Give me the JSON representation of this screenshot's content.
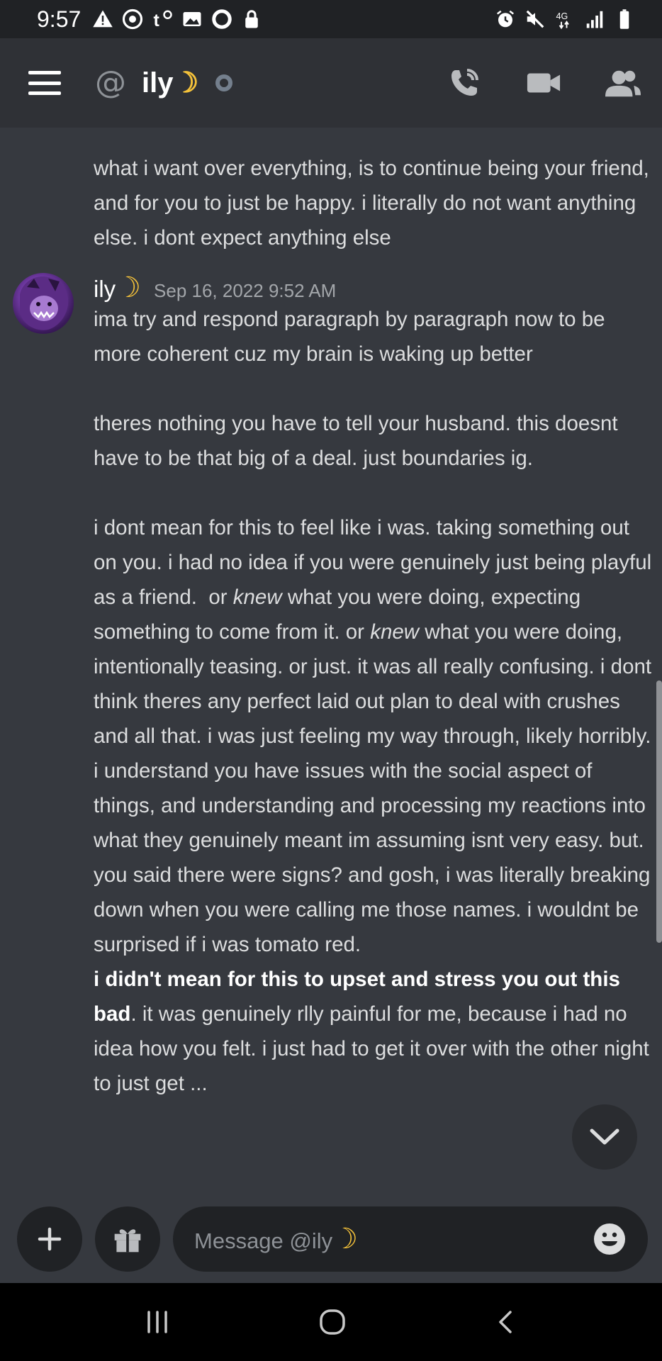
{
  "status_bar": {
    "time": "9:57",
    "left_icons": [
      "warning-icon",
      "steam-icon",
      "tumblr-icon",
      "gallery-icon",
      "app-icon",
      "lock-icon"
    ],
    "right_icons": [
      "alarm-icon",
      "mute-icon",
      "4g-icon",
      "signal-icon",
      "battery-icon"
    ],
    "network": "4G"
  },
  "header": {
    "menu_icon": "hamburger-icon",
    "at_symbol": "@",
    "title": "ily",
    "title_emoji": "☽",
    "status": "offline",
    "actions": [
      "call-icon",
      "video-icon",
      "members-icon"
    ]
  },
  "messages": {
    "continuation_text": "what i want over everything, is to continue being your friend, and for you to just be happy. i literally do not want anything else. i dont expect anything else",
    "group": {
      "author": "ily",
      "author_emoji": "☽",
      "timestamp": "Sep 16, 2022 9:52 AM",
      "p1": "ima try and respond paragraph by paragraph now to be more coherent cuz my brain is waking up better",
      "p2": "theres nothing you have to tell your husband. this doesnt have to be that big of a deal. just boundaries ig.",
      "p3_a": "i dont mean for this to feel like i was. taking something out on you. i had no idea if you were genuinely just being playful as a friend.  or ",
      "p3_em1": "knew",
      "p3_b": " what you were doing, expecting something to come from it. or ",
      "p3_em2": "knew",
      "p3_c": " what you were doing, intentionally teasing. or just. it was all really confusing. i dont think theres any perfect laid out plan to deal with crushes and all that. i was just feeling my way through, likely horribly.",
      "p4": "i understand you have issues with the social aspect of things, and understanding and processing my reactions into what they genuinely meant im assuming isnt very easy. but. you said there were signs? and gosh, i was literally breaking down when you were calling me those names. i wouldnt be surprised if i was tomato red.",
      "p5_bold": "i didn't mean for this to upset and stress you out this bad",
      "p5_rest": ". it was genuinely rlly painful for me, because i had no idea how you felt. i just had to get it over with the other night to just get ..."
    }
  },
  "composer": {
    "add_icon": "plus-icon",
    "gift_icon": "gift-icon",
    "placeholder": "Message @ily",
    "placeholder_emoji": "☽",
    "emoji_icon": "smiley-icon"
  },
  "jump_button": {
    "icon": "chevron-down-icon"
  },
  "navbar": {
    "icons": [
      "recents-icon",
      "home-icon",
      "back-icon"
    ]
  }
}
